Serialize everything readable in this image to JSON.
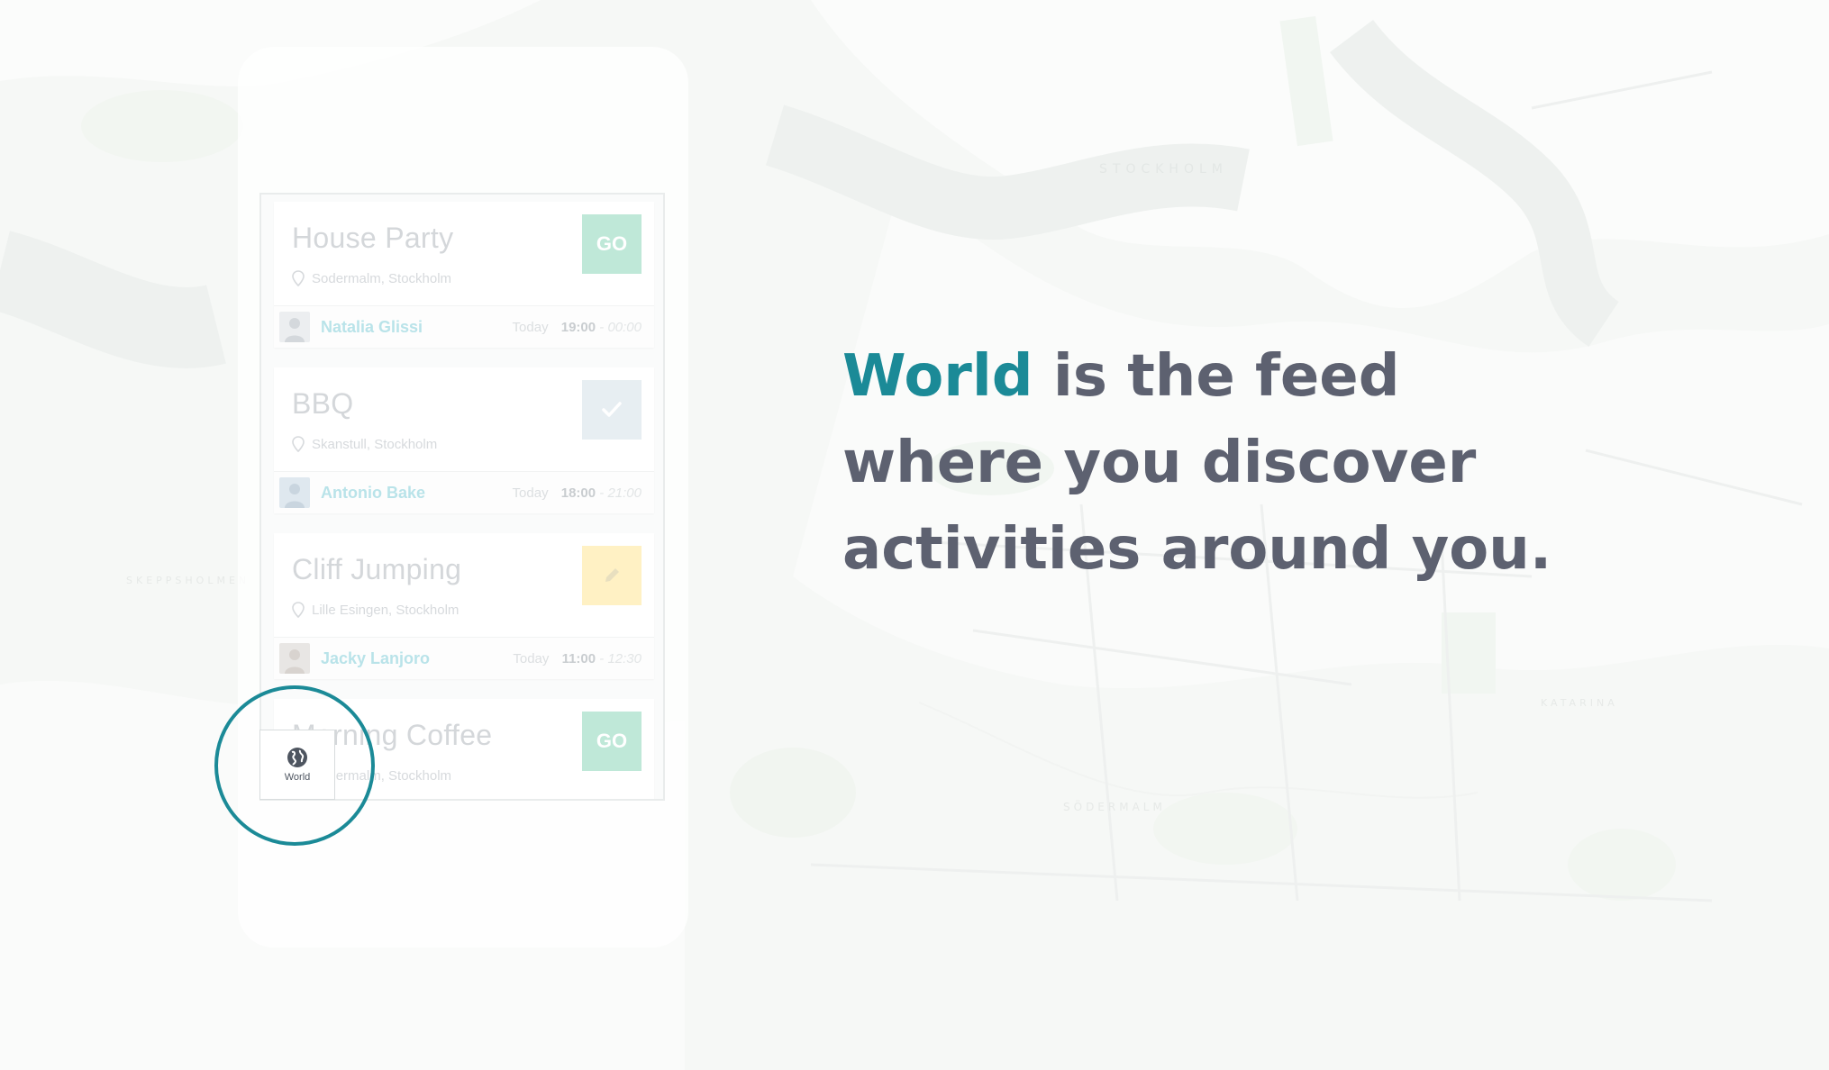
{
  "colors": {
    "accent": "#1b8a97",
    "headline_text": "#5d6170",
    "go_button": "#bfe8d8",
    "check_button": "#e7eef2",
    "edit_button": "#fff1c4"
  },
  "map": {
    "city_label": "STOCKHOLM",
    "district_labels": [
      "SÖDERMALM",
      "KATARINA",
      "SKEPPSHOLMEN"
    ]
  },
  "feed": {
    "cards": [
      {
        "title": "House Party",
        "location": "Sodermalm, Stockholm",
        "action": "GO",
        "action_icon": "none",
        "host": "Natalia Glissi",
        "day": "Today",
        "start": "19:00",
        "end": "- 00:00"
      },
      {
        "title": "BBQ",
        "location": "Skanstull, Stockholm",
        "action": "",
        "action_icon": "check-icon",
        "host": "Antonio Bake",
        "day": "Today",
        "start": "18:00",
        "end": "- 21:00"
      },
      {
        "title": "Cliff Jumping",
        "location": "Lille Esingen, Stockholm",
        "action": "",
        "action_icon": "pencil-icon",
        "host": "Jacky Lanjoro",
        "day": "Today",
        "start": "11:00",
        "end": "- 12:30"
      },
      {
        "title": "Morning Coffee",
        "location": "Sodermalm, Stockholm",
        "action": "GO",
        "action_icon": "none"
      }
    ]
  },
  "tab": {
    "icon": "globe-icon",
    "label": "World"
  },
  "headline": {
    "accent": "World",
    "line1_rest": " is the feed",
    "line2": "where you discover",
    "line3": "activities around you."
  }
}
